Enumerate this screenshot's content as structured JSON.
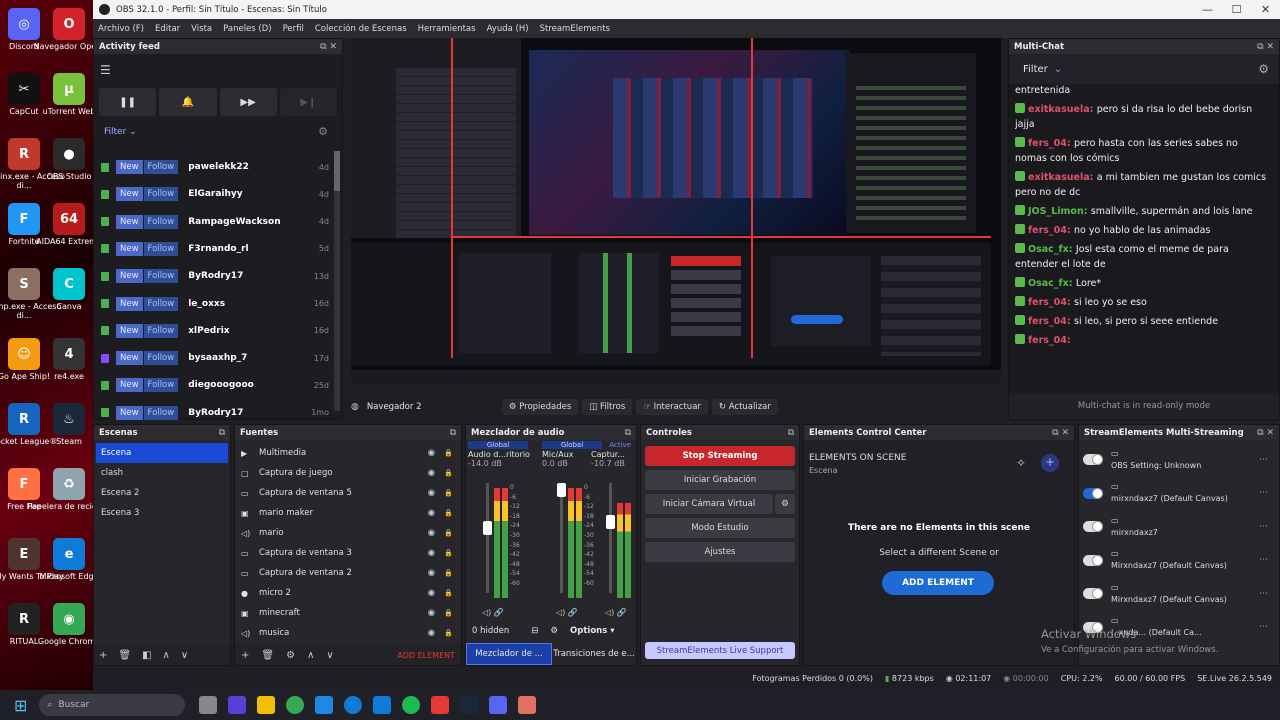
{
  "desktop": {
    "icons": [
      {
        "label": "Discord",
        "color": "#5865f2",
        "glyph": "◎"
      },
      {
        "label": "Navegador Opera",
        "color": "#d2232a",
        "glyph": "O"
      },
      {
        "label": "CapCut",
        "color": "#111111",
        "glyph": "✂"
      },
      {
        "label": "uTorrent Web",
        "color": "#78c13c",
        "glyph": "μ"
      },
      {
        "label": "Ryujinx.exe - Acceso di...",
        "color": "#c0392b",
        "glyph": "R"
      },
      {
        "label": "OBS Studio",
        "color": "#2a2a2a",
        "glyph": "●"
      },
      {
        "label": "Fortnite",
        "color": "#2196f3",
        "glyph": "F"
      },
      {
        "label": "AIDA64 Extreme",
        "color": "#b71c1c",
        "glyph": "64"
      },
      {
        "label": "samp.exe - Acceso di...",
        "color": "#8d6e63",
        "glyph": "S"
      },
      {
        "label": "Canva",
        "color": "#00c4cc",
        "glyph": "C"
      },
      {
        "label": "Go Ape Ship!",
        "color": "#f39c12",
        "glyph": "☺"
      },
      {
        "label": "re4.exe",
        "color": "#333333",
        "glyph": "4"
      },
      {
        "label": "Rocket League®",
        "color": "#1565c0",
        "glyph": "R"
      },
      {
        "label": "Steam",
        "color": "#1b2838",
        "glyph": "♨"
      },
      {
        "label": "Free Fire",
        "color": "#ff7043",
        "glyph": "F"
      },
      {
        "label": "Papelera de reciclaje",
        "color": "#90a4ae",
        "glyph": "♻"
      },
      {
        "label": "Emily Wants To Play",
        "color": "#4e342e",
        "glyph": "E"
      },
      {
        "label": "Microsoft Edge",
        "color": "#0f7bd6",
        "glyph": "e"
      },
      {
        "label": "RITUAL",
        "color": "#222222",
        "glyph": "R"
      },
      {
        "label": "Google Chrome",
        "color": "#34a853",
        "glyph": "◉"
      }
    ]
  },
  "window": {
    "title": "OBS 32.1.0 - Perfil: Sin Título - Escenas: Sin Título"
  },
  "menu": [
    "Archivo (F)",
    "Editar",
    "Vista",
    "Paneles (D)",
    "Perfil",
    "Colección de Escenas",
    "Herramientas",
    "Ayuda (H)",
    "StreamElements"
  ],
  "activity_feed": {
    "title": "Activity feed",
    "filter_label": "Filter",
    "new_label": "New",
    "follow_label": "Follow",
    "items": [
      {
        "name": "pawelekk22",
        "time": "4d",
        "platform": "twitch"
      },
      {
        "name": "ElGaraihyy",
        "time": "4d",
        "platform": "twitch"
      },
      {
        "name": "RampageWackson",
        "time": "4d",
        "platform": "twitch"
      },
      {
        "name": "F3rnando_rl",
        "time": "5d",
        "platform": "twitch"
      },
      {
        "name": "ByRodry17",
        "time": "13d",
        "platform": "twitch"
      },
      {
        "name": "le_oxxs",
        "time": "16d",
        "platform": "twitch"
      },
      {
        "name": "xlPedrix",
        "time": "16d",
        "platform": "twitch"
      },
      {
        "name": "bysaaxhp_7",
        "time": "17d",
        "platform": "twitch-purple"
      },
      {
        "name": "diegooogooo",
        "time": "25d",
        "platform": "twitch"
      },
      {
        "name": "ByRodry17",
        "time": "1mo",
        "platform": "twitch"
      }
    ]
  },
  "preview": {
    "source_label": "Navegador 2",
    "buttons": [
      "Propiedades",
      "Filtros",
      "Interactuar",
      "Actualizar"
    ]
  },
  "multichat": {
    "title": "Multi-Chat",
    "filter_label": "Filter",
    "footer": "Multi-chat is in read-only mode",
    "messages": [
      {
        "user": "",
        "text": "entretenida",
        "color": "#ffffff"
      },
      {
        "user": "exitkasuela:",
        "text": "pero si da risa lo del bebe dorisn jajja",
        "color": "#e05070"
      },
      {
        "user": "fers_04:",
        "text": "pero hasta con las series sabes no nomas con los cómics",
        "color": "#e05070"
      },
      {
        "user": "exitkasuela:",
        "text": "a mi tambien me gustan los comics pero no de dc",
        "color": "#e05070"
      },
      {
        "user": "JOS_Limon:",
        "text": "smallville, supermán and lois lane",
        "color": "#5aba4a"
      },
      {
        "user": "fers_04:",
        "text": "no yo hablo de las animadas",
        "color": "#e05070"
      },
      {
        "user": "Osac_fx:",
        "text": "Josl esta como el meme de para entender el lote de",
        "color": "#5aba4a"
      },
      {
        "user": "Osac_fx:",
        "text": "Lore*",
        "color": "#5aba4a"
      },
      {
        "user": "fers_04:",
        "text": "si leo yo se eso",
        "color": "#e05070"
      },
      {
        "user": "fers_04:",
        "text": "si leo, si pero si seee entiende",
        "color": "#e05070"
      },
      {
        "user": "fers_04:",
        "text": "",
        "color": "#e05070"
      }
    ]
  },
  "scenes": {
    "title": "Escenas",
    "items": [
      "Escena",
      "clash",
      "Escena 2",
      "Escena 3"
    ]
  },
  "sources": {
    "title": "Fuentes",
    "items": [
      {
        "name": "Multimedia",
        "icon": "play-icon"
      },
      {
        "name": "Captura de juego",
        "icon": "gamepad-icon"
      },
      {
        "name": "Captura de ventana 5",
        "icon": "window-icon"
      },
      {
        "name": "mario maker",
        "icon": "image-icon"
      },
      {
        "name": "mario",
        "icon": "speaker-icon"
      },
      {
        "name": "Captura de ventana 3",
        "icon": "window-icon"
      },
      {
        "name": "Captura de ventana 2",
        "icon": "window-icon"
      },
      {
        "name": "micro 2",
        "icon": "mic-icon"
      },
      {
        "name": "minecraft",
        "icon": "image-icon"
      },
      {
        "name": "musica",
        "icon": "speaker-icon"
      }
    ],
    "add_element": "ADD ELEMENT"
  },
  "mixer": {
    "title": "Mezclador de audio",
    "channels": [
      {
        "tag": "Global",
        "name": "Audio d...ritorio",
        "db": "-14.0 dB"
      },
      {
        "tag": "Global",
        "name": "Mic/Aux",
        "db": "0.0 dB"
      },
      {
        "tag": "Active",
        "name": "Captur...",
        "db": "-10.7 dB"
      }
    ],
    "scale": [
      "0",
      "-6",
      "-12",
      "-18",
      "-24",
      "-30",
      "-36",
      "-42",
      "-48",
      "-54",
      "-60"
    ],
    "hidden_label": "0 hidden",
    "options_label": "Options",
    "tabs": [
      "Mezclador de ...",
      "Transiciones de e..."
    ]
  },
  "controls": {
    "title": "Controles",
    "stop_streaming": "Stop Streaming",
    "start_recording": "Iniciar Grabación",
    "virtual_camera": "Iniciar Cámara Virtual",
    "studio_mode": "Modo Estudio",
    "settings": "Ajustes",
    "live_support": "StreamElements Live Support"
  },
  "elements_center": {
    "title": "Elements Control Center",
    "on_scene": "ELEMENTS ON SCENE",
    "scene_name": "Escena",
    "empty_title": "There are no Elements in this scene",
    "empty_sub": "Select a different Scene or",
    "add_button": "ADD ELEMENT"
  },
  "multistream": {
    "title": "StreamElements Multi-Streaming",
    "rows": [
      {
        "text": "OBS Setting: Unknown",
        "on": false
      },
      {
        "text": "mirxndaxz7 (Default Canvas)",
        "on": true
      },
      {
        "text": "mirxndaxz7",
        "on": false
      },
      {
        "text": "Mirxndaxz7 (Default Canvas)",
        "on": false
      },
      {
        "text": "Mirxndaxz7 (Default Canvas)",
        "on": false
      },
      {
        "text": "...xnda... (Default Ca...",
        "on": false
      }
    ]
  },
  "watermark": {
    "line1": "Activar Windows",
    "line2": "Ve a Configuración para activar Windows."
  },
  "status": {
    "dropped": "Fotogramas Perdidos 0 (0.0%)",
    "bitrate": "8723 kbps",
    "live_time": "02:11:07",
    "rec_time": "00:00:00",
    "cpu": "CPU: 2.2%",
    "fps": "60.00 / 60.00 FPS",
    "version": "SE.Live 26.2.5.549"
  },
  "taskbar": {
    "search_placeholder": "Buscar"
  }
}
